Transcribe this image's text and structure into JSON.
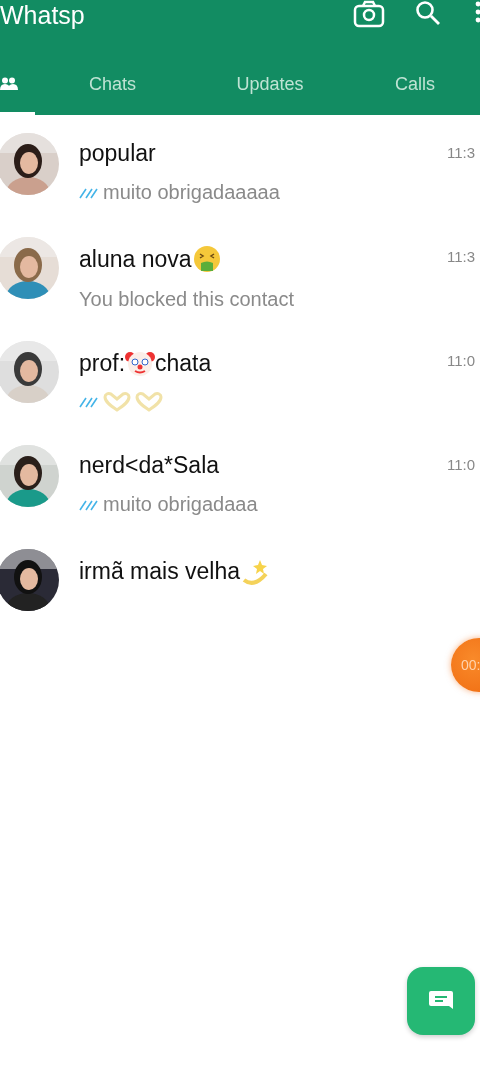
{
  "header": {
    "title": "Whatsp"
  },
  "tabs": [
    {
      "kind": "community",
      "selected": true
    },
    {
      "kind": "label",
      "label": "Chats",
      "selected": false
    },
    {
      "kind": "label",
      "label": "Updates",
      "selected": false
    },
    {
      "kind": "label",
      "label": "Calls",
      "selected": false
    }
  ],
  "chats": [
    {
      "name": [
        {
          "kind": "text",
          "text": "popular"
        }
      ],
      "time": "11:3",
      "read": true,
      "preview": [
        {
          "kind": "text",
          "text": "muito obrigadaaaaa"
        }
      ],
      "avatar": {
        "kind": "picture"
      }
    },
    {
      "name": [
        {
          "kind": "text",
          "text": "aluna nova"
        },
        {
          "kind": "nauseated"
        }
      ],
      "time": "11:3",
      "read": false,
      "preview": [
        {
          "kind": "text",
          "text": "You blocked this contact"
        }
      ],
      "avatar": {
        "kind": "picture"
      }
    },
    {
      "name": [
        {
          "kind": "text",
          "text": "prof:"
        },
        {
          "kind": "clown"
        },
        {
          "kind": "text",
          "text": "chata"
        }
      ],
      "time": "11:0",
      "read": true,
      "preview": [
        {
          "kind": "hearthands"
        },
        {
          "kind": "hearthands"
        }
      ],
      "avatar": {
        "kind": "picture"
      }
    },
    {
      "name": [
        {
          "kind": "text",
          "text": "nerd<da*Sala"
        }
      ],
      "time": "11:0",
      "read": true,
      "preview": [
        {
          "kind": "text",
          "text": "muito obrigadaaa"
        }
      ],
      "avatar": {
        "kind": "picture"
      }
    },
    {
      "name": [
        {
          "kind": "text",
          "text": "irmã mais velha"
        },
        {
          "kind": "dizzy"
        }
      ],
      "avatar": {
        "kind": "picture"
      }
    }
  ],
  "recording": {
    "time": "00:"
  }
}
